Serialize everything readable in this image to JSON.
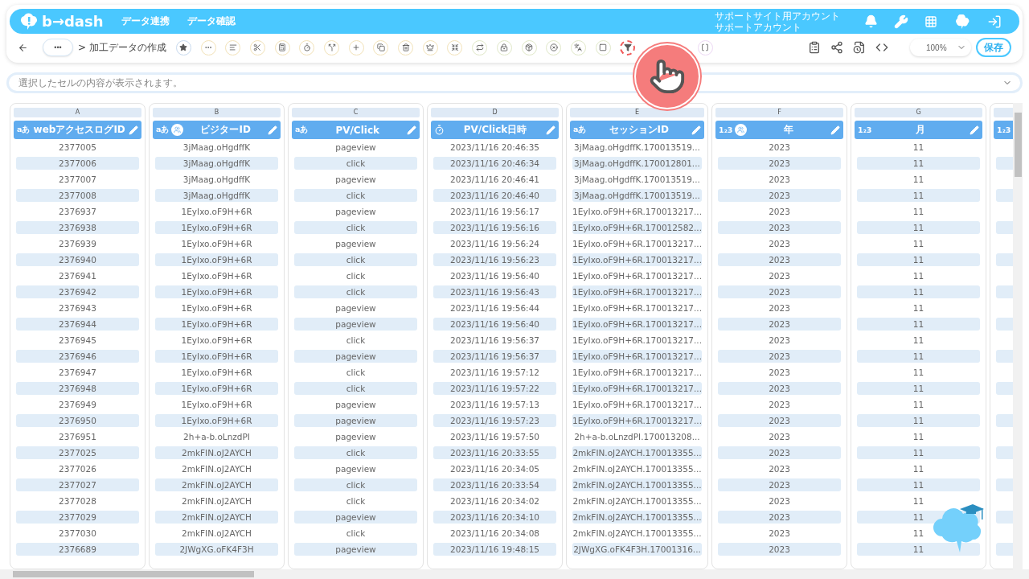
{
  "header": {
    "logo": "b→dash",
    "nav": [
      "データ連携",
      "データ確認"
    ],
    "account": [
      "サポートサイト用アカウント",
      "サポートアカウント"
    ]
  },
  "toolbar": {
    "more": "•••",
    "breadcrumb": "> 加工データの作成",
    "zoom": "100%",
    "save": "保存"
  },
  "formula_bar": {
    "placeholder": "選択したセルの内容が表示されます。"
  },
  "columns": [
    {
      "letter": "A",
      "title": "webアクセスログID",
      "kind": "text",
      "type_label": "aあ",
      "grouped": false
    },
    {
      "letter": "B",
      "title": "ビジターID",
      "kind": "text",
      "type_label": "aあ",
      "grouped": true
    },
    {
      "letter": "C",
      "title": "PV/Click",
      "kind": "text",
      "type_label": "aあ",
      "grouped": false
    },
    {
      "letter": "D",
      "title": "PV/Click日時",
      "kind": "datetime",
      "grouped": false
    },
    {
      "letter": "E",
      "title": "セッションID",
      "kind": "text",
      "type_label": "aあ",
      "grouped": false
    },
    {
      "letter": "F",
      "title": "年",
      "kind": "number",
      "type_label": "1₂3",
      "grouped": true
    },
    {
      "letter": "G",
      "title": "月",
      "kind": "number",
      "type_label": "1₂3",
      "grouped": false
    },
    {
      "kind": "number",
      "type_label": "1₂3",
      "grouped": false
    }
  ],
  "rows": [
    [
      "2377005",
      "3jMaag.oHgdffK",
      "pageview",
      "2023/11/16 20:46:35",
      "3jMaag.oHgdffK.170013519...",
      "2023",
      "11"
    ],
    [
      "2377006",
      "3jMaag.oHgdffK",
      "click",
      "2023/11/16 20:46:34",
      "3jMaag.oHgdffK.170012801...",
      "2023",
      "11"
    ],
    [
      "2377007",
      "3jMaag.oHgdffK",
      "pageview",
      "2023/11/16 20:46:41",
      "3jMaag.oHgdffK.170013519...",
      "2023",
      "11"
    ],
    [
      "2377008",
      "3jMaag.oHgdffK",
      "click",
      "2023/11/16 20:46:40",
      "3jMaag.oHgdffK.170013519...",
      "2023",
      "11"
    ],
    [
      "2376937",
      "1EyIxo.oF9H+6R",
      "pageview",
      "2023/11/16 19:56:17",
      "1EyIxo.oF9H+6R.170013217...",
      "2023",
      "11"
    ],
    [
      "2376938",
      "1EyIxo.oF9H+6R",
      "click",
      "2023/11/16 19:56:16",
      "1EyIxo.oF9H+6R.170012582...",
      "2023",
      "11"
    ],
    [
      "2376939",
      "1EyIxo.oF9H+6R",
      "pageview",
      "2023/11/16 19:56:24",
      "1EyIxo.oF9H+6R.170013217...",
      "2023",
      "11"
    ],
    [
      "2376940",
      "1EyIxo.oF9H+6R",
      "click",
      "2023/11/16 19:56:23",
      "1EyIxo.oF9H+6R.170013217...",
      "2023",
      "11"
    ],
    [
      "2376941",
      "1EyIxo.oF9H+6R",
      "click",
      "2023/11/16 19:56:40",
      "1EyIxo.oF9H+6R.170013217...",
      "2023",
      "11"
    ],
    [
      "2376942",
      "1EyIxo.oF9H+6R",
      "click",
      "2023/11/16 19:56:43",
      "1EyIxo.oF9H+6R.170013217...",
      "2023",
      "11"
    ],
    [
      "2376943",
      "1EyIxo.oF9H+6R",
      "pageview",
      "2023/11/16 19:56:44",
      "1EyIxo.oF9H+6R.170013217...",
      "2023",
      "11"
    ],
    [
      "2376944",
      "1EyIxo.oF9H+6R",
      "pageview",
      "2023/11/16 19:56:40",
      "1EyIxo.oF9H+6R.170013217...",
      "2023",
      "11"
    ],
    [
      "2376945",
      "1EyIxo.oF9H+6R",
      "click",
      "2023/11/16 19:56:37",
      "1EyIxo.oF9H+6R.170013217...",
      "2023",
      "11"
    ],
    [
      "2376946",
      "1EyIxo.oF9H+6R",
      "pageview",
      "2023/11/16 19:56:37",
      "1EyIxo.oF9H+6R.170013217...",
      "2023",
      "11"
    ],
    [
      "2376947",
      "1EyIxo.oF9H+6R",
      "click",
      "2023/11/16 19:57:12",
      "1EyIxo.oF9H+6R.170013217...",
      "2023",
      "11"
    ],
    [
      "2376948",
      "1EyIxo.oF9H+6R",
      "click",
      "2023/11/16 19:57:22",
      "1EyIxo.oF9H+6R.170013217...",
      "2023",
      "11"
    ],
    [
      "2376949",
      "1EyIxo.oF9H+6R",
      "pageview",
      "2023/11/16 19:57:13",
      "1EyIxo.oF9H+6R.170013217...",
      "2023",
      "11"
    ],
    [
      "2376950",
      "1EyIxo.oF9H+6R",
      "pageview",
      "2023/11/16 19:57:23",
      "1EyIxo.oF9H+6R.170013217...",
      "2023",
      "11"
    ],
    [
      "2376951",
      "2h+a-b.oLnzdPI",
      "pageview",
      "2023/11/16 19:57:50",
      "2h+a-b.oLnzdPI.170013208...",
      "2023",
      "11"
    ],
    [
      "2377025",
      "2mkFIN.oJ2AYCH",
      "click",
      "2023/11/16 20:33:55",
      "2mkFIN.oJ2AYCH.170013355...",
      "2023",
      "11"
    ],
    [
      "2377026",
      "2mkFIN.oJ2AYCH",
      "pageview",
      "2023/11/16 20:34:05",
      "2mkFIN.oJ2AYCH.170013355...",
      "2023",
      "11"
    ],
    [
      "2377027",
      "2mkFIN.oJ2AYCH",
      "click",
      "2023/11/16 20:33:54",
      "2mkFIN.oJ2AYCH.170013355...",
      "2023",
      "11"
    ],
    [
      "2377028",
      "2mkFIN.oJ2AYCH",
      "click",
      "2023/11/16 20:34:02",
      "2mkFIN.oJ2AYCH.170013355...",
      "2023",
      "11"
    ],
    [
      "2377029",
      "2mkFIN.oJ2AYCH",
      "pageview",
      "2023/11/16 20:34:10",
      "2mkFIN.oJ2AYCH.170013355...",
      "2023",
      "11"
    ],
    [
      "2377030",
      "2mkFIN.oJ2AYCH",
      "click",
      "2023/11/16 20:34:08",
      "2mkFIN.oJ2AYCH.170013355...",
      "2023",
      "11"
    ],
    [
      "2376689",
      "2JWgXG.oFK4F3H",
      "pageview",
      "2023/11/16 19:48:15",
      "2JWgXG.oFK4F3H.17001316...",
      "2023",
      "11"
    ]
  ]
}
